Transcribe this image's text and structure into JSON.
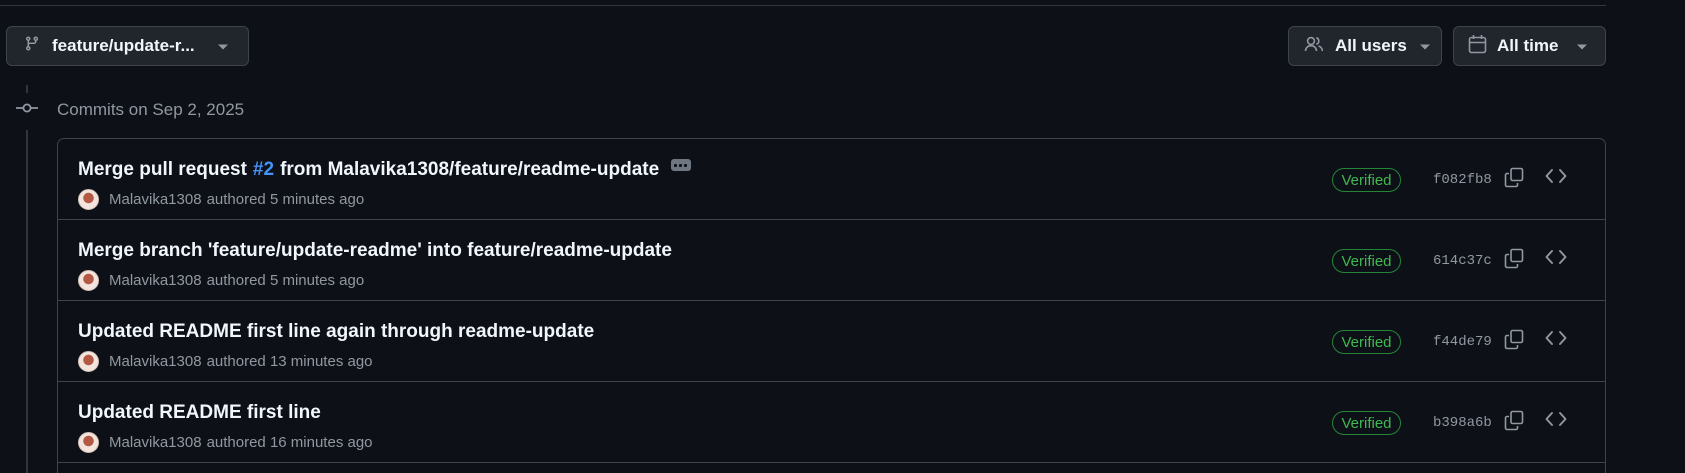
{
  "filters": {
    "branch_label": "feature/update-r...",
    "users_label": "All users",
    "time_label": "All time"
  },
  "timeline": {
    "date_heading": "Commits on Sep 2, 2025"
  },
  "commits": [
    {
      "title_before": "Merge pull request",
      "pr_link": "#2",
      "title_after": "from Malavika1308/feature/readme-update",
      "author": "Malavika1308",
      "authored": "authored 5 minutes ago",
      "verified": "Verified",
      "sha": "f082fb8",
      "has_ellipsis": true
    },
    {
      "title": "Merge branch 'feature/update-readme' into feature/readme-update",
      "author": "Malavika1308",
      "authored": "authored 5 minutes ago",
      "verified": "Verified",
      "sha": "614c37c"
    },
    {
      "title": "Updated README first line again through readme-update",
      "author": "Malavika1308",
      "authored": "authored 13 minutes ago",
      "verified": "Verified",
      "sha": "f44de79"
    },
    {
      "title": "Updated README first line",
      "author": "Malavika1308",
      "authored": "authored 16 minutes ago",
      "verified": "Verified",
      "sha": "b398a6b"
    }
  ],
  "icons": {
    "branch": "git-branch-icon",
    "users": "people-icon",
    "time": "calendar-icon",
    "caret": "triangle-down-icon",
    "commit": "git-commit-icon",
    "copy": "copy-icon",
    "browse": "code-icon"
  },
  "colors": {
    "background": "#0d1117",
    "border": "#3d444d",
    "link": "#4493f8",
    "verified": "#3fb950"
  }
}
